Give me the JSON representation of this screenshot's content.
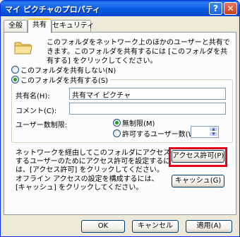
{
  "window": {
    "title": "マイ ピクチャのプロパティ"
  },
  "titlebar": {
    "help_glyph": "?",
    "close_glyph": "✕"
  },
  "tabs": [
    {
      "label": "全般"
    },
    {
      "label": "共有"
    },
    {
      "label": "セキュリティ"
    }
  ],
  "intro": {
    "text": "このフォルダをネットワーク上のほかのユーザーと共有できます。このフォルダを共有するには [このフォルダを共有する] をクリックしてください。"
  },
  "share_options": {
    "no_share": "このフォルダを共有しない(N)",
    "share": "このフォルダを共有する(S)"
  },
  "fields": {
    "share_name_label": "共有名(H):",
    "share_name_value": "共有マイ ピクチャ",
    "comment_label": "コメント(C):",
    "comment_value": "",
    "user_limit_label": "ユーザー数制限:",
    "unlimited": "無制限(M)",
    "allowed_users": "許可するユーザー数(W)"
  },
  "permissions": {
    "text": "ネットワークを経由してこのフォルダにアクセスするユーザーのためにアクセス許可を設定するには、[アクセス許可] をクリックしてください。",
    "button": "アクセス許可(P)"
  },
  "caching": {
    "text": "オフライン アクセスの設定を構成するには、[キャッシュ] をクリックしてください。",
    "button": "キャッシュ(G)"
  },
  "footer": {
    "ok": "OK",
    "cancel": "キャンセル",
    "apply": "適用(A)"
  }
}
